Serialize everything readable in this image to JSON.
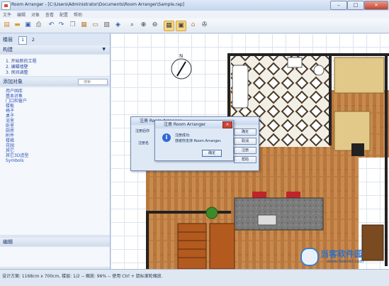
{
  "window": {
    "title": "Room Arranger - [C:\\Users\\Administrator\\Documents\\Room Arranger\\Sample.rap]",
    "minimize": "–",
    "maximize": "□",
    "close": "×"
  },
  "menu": [
    "文件",
    "编辑",
    "对象",
    "查看",
    "配置",
    "帮助"
  ],
  "left": {
    "floor_label": "楼层",
    "floor_tabs": [
      "1",
      "2"
    ],
    "build_header": "构建",
    "build_steps": [
      "1.  开始新的工程",
      "2.  编辑墙壁",
      "3.  房间调整"
    ],
    "add_header": "添加对象",
    "search_placeholder": "搜索",
    "categories": [
      "用户固库",
      "基本对象",
      "门口和窗户",
      "楼板",
      "椅子",
      "桌子",
      "浴室",
      "卧室",
      "厨房",
      "附件",
      "楼梯",
      "花园",
      "其它",
      "其它3D造型",
      "Symbols"
    ],
    "edit_header": "编辑"
  },
  "status": "设计方案: 1168cm x 700cm, 楼层: 1/2 -- 缩放: 96% -- 使用 Ctrl + 鼠标滚轮缩放.",
  "dialog_register": {
    "title": "注册 Room Arranger",
    "label1": "注册后你",
    "label2": "注册名",
    "buttons": [
      "确定",
      "取消",
      "注册",
      "帮助"
    ]
  },
  "dialog_success": {
    "title": "注册 Room Arranger",
    "line1": "注册成功.",
    "line2": "感谢你支持 Room Arranger.",
    "ok": "确定",
    "close": "×"
  },
  "watermark": {
    "brand": "当客软件园",
    "url": "www.downkr.com"
  },
  "colors": {
    "accent": "#f6d683",
    "wood": "#c98b4d",
    "wall": "#222222"
  }
}
